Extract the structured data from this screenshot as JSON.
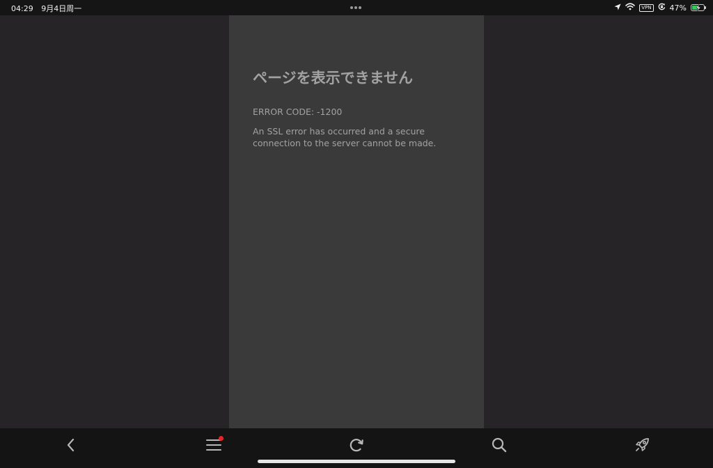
{
  "status_bar": {
    "time": "04:29",
    "date": "9月4日周一",
    "vpn_label": "VPN",
    "battery_percent": "47%",
    "battery_level": 0.47,
    "icons": [
      "location-arrow-icon",
      "wifi-icon",
      "vpn-icon",
      "rotation-lock-icon",
      "battery-charging-icon"
    ]
  },
  "error_page": {
    "title": "ページを表示できません",
    "code": "ERROR CODE: -1200",
    "message": "An SSL error has occurred and a secure connection to the server cannot be made."
  },
  "toolbar": {
    "buttons": [
      "back-icon",
      "menu-icon",
      "reload-icon",
      "search-icon",
      "rocket-icon"
    ],
    "menu_badge_color": "#e5252a"
  },
  "colors": {
    "text": "#a2a2a2",
    "panel": "#3a3a3b",
    "background": "#262426",
    "battery": "#34c759"
  }
}
